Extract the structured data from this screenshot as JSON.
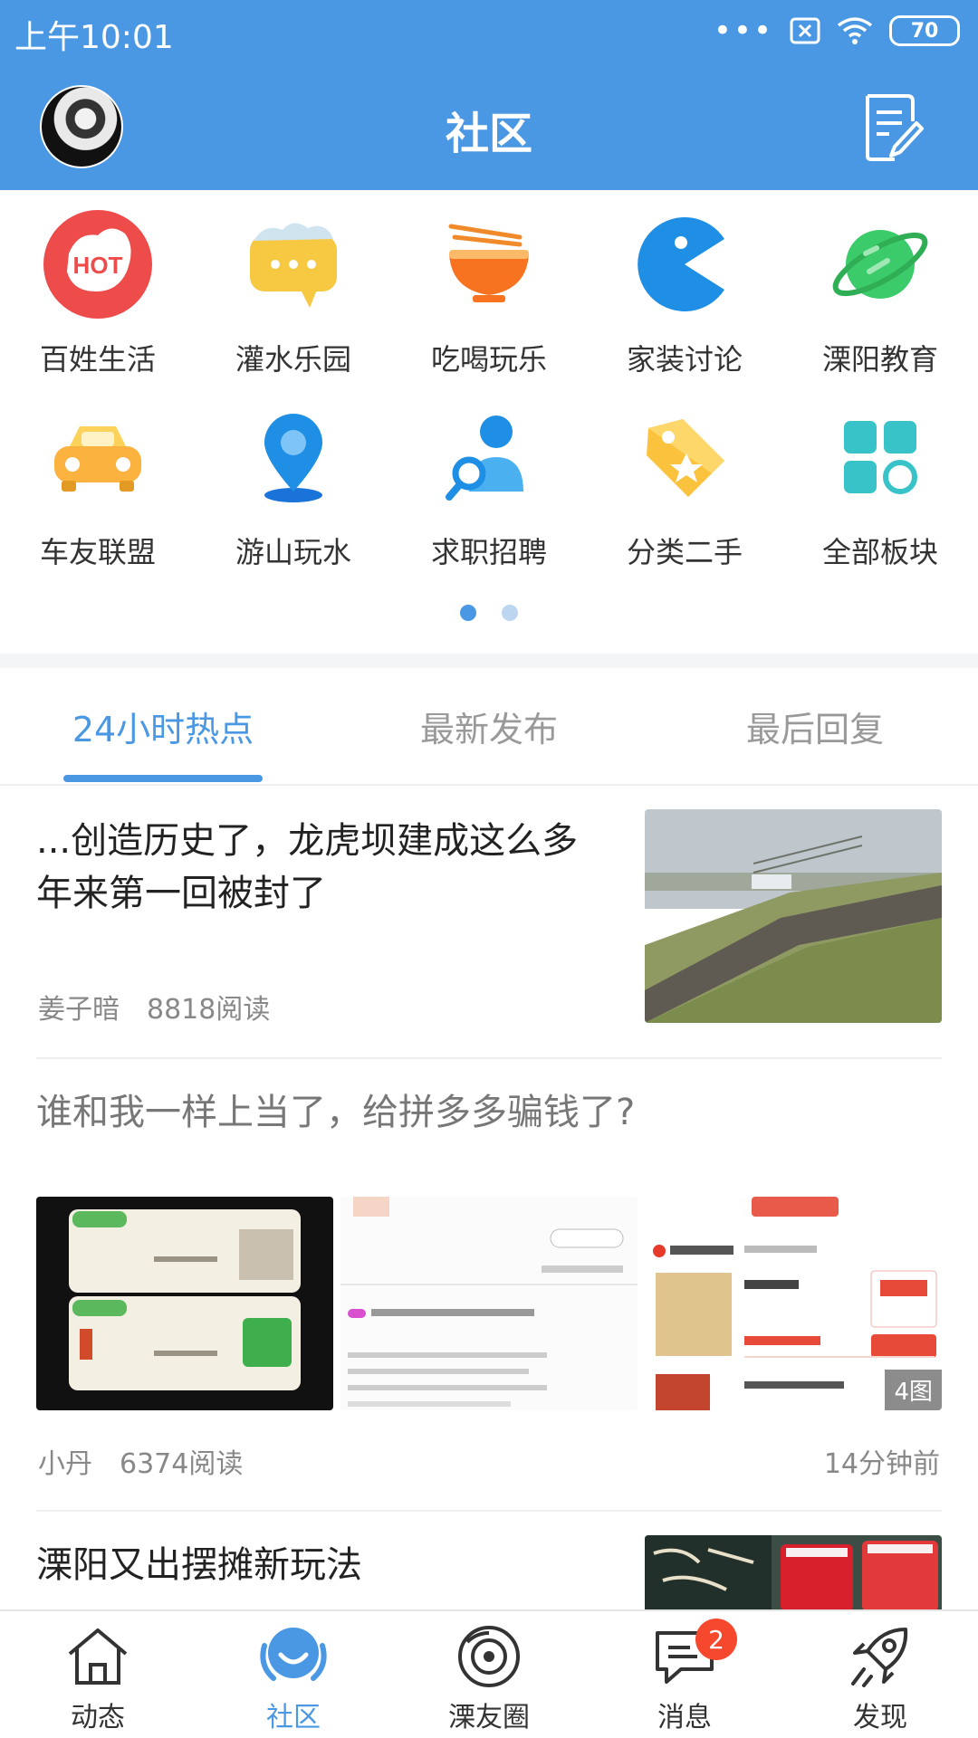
{
  "status_bar": {
    "time": "上午10:01",
    "more": "•••",
    "battery": "70"
  },
  "header": {
    "title": "社区"
  },
  "categories": [
    {
      "label": "百姓生活",
      "icon": "hot-icon",
      "badge_text": "HOT"
    },
    {
      "label": "灌水乐园",
      "icon": "chat-bubble-icon"
    },
    {
      "label": "吃喝玩乐",
      "icon": "noodle-bowl-icon"
    },
    {
      "label": "家装讨论",
      "icon": "pacman-icon"
    },
    {
      "label": "溧阳教育",
      "icon": "planet-icon"
    },
    {
      "label": "车友联盟",
      "icon": "car-icon"
    },
    {
      "label": "游山玩水",
      "icon": "location-pin-icon"
    },
    {
      "label": "求职招聘",
      "icon": "job-search-icon"
    },
    {
      "label": "分类二手",
      "icon": "tag-icon"
    },
    {
      "label": "全部板块",
      "icon": "grid-icon"
    }
  ],
  "tabs": [
    {
      "label": "24小时热点",
      "active": true
    },
    {
      "label": "最新发布",
      "active": false
    },
    {
      "label": "最后回复",
      "active": false
    }
  ],
  "posts": [
    {
      "title": "...创造历史了，龙虎坝建成这么多年来第一回被封了",
      "author": "姜子暗",
      "reads": "8818阅读"
    },
    {
      "title": "谁和我一样上当了，给拼多多骗钱了?",
      "author": "小丹",
      "reads": "6374阅读",
      "time": "14分钟前",
      "image_count": "4图"
    },
    {
      "title": "溧阳又出摆摊新玩法"
    }
  ],
  "bottom_nav": [
    {
      "label": "动态",
      "icon": "home-icon"
    },
    {
      "label": "社区",
      "icon": "community-icon",
      "active": true
    },
    {
      "label": "溧友圈",
      "icon": "circle-icon"
    },
    {
      "label": "消息",
      "icon": "message-icon",
      "badge": "2"
    },
    {
      "label": "发现",
      "icon": "rocket-icon"
    }
  ],
  "colors": {
    "primary": "#4a98e4",
    "badge": "#f5482c"
  }
}
